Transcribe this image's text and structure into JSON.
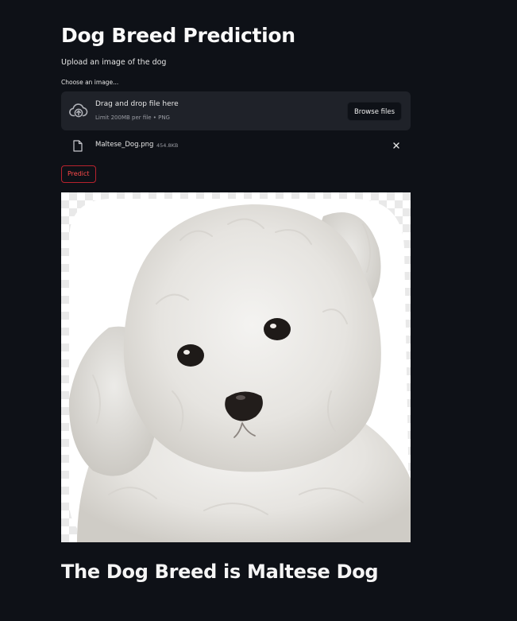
{
  "app": {
    "title": "Dog Breed Prediction",
    "subtitle": "Upload an image of the dog"
  },
  "uploader": {
    "label": "Choose an image...",
    "drop_text": "Drag and drop file here",
    "limit_text": "Limit 200MB per file • PNG",
    "browse_label": "Browse files",
    "upload_icon": "cloud-upload-icon"
  },
  "uploaded_file": {
    "name": "Maltese_Dog.png",
    "size": "454.8KB",
    "file_icon": "file-icon",
    "remove_icon": "close-icon"
  },
  "predict_button": {
    "label": "Predict"
  },
  "image": {
    "description_name": "dog-image"
  },
  "result": {
    "text": "The Dog Breed is Maltese Dog"
  },
  "colors": {
    "background": "#0e1117",
    "dropzone": "#1f2229",
    "accent": "#ff4b4b",
    "text": "#fafafa",
    "muted": "#9a9ca3"
  }
}
